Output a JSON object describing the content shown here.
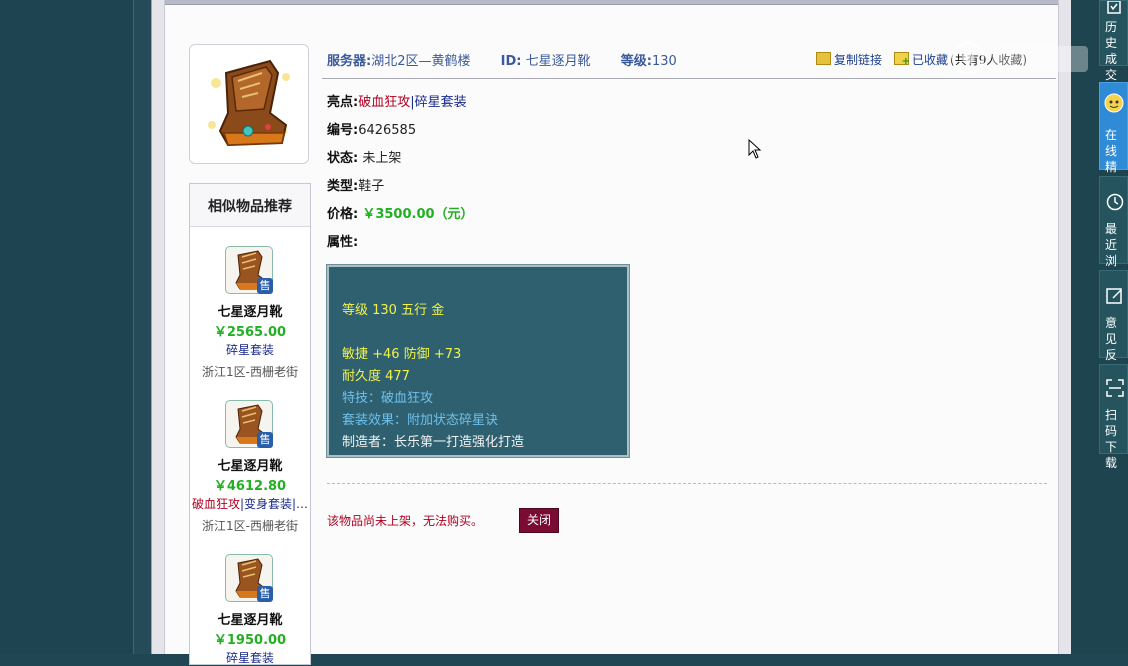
{
  "header": {
    "server_label": "服务器:",
    "server_value": "湖北2区—黄鹤楼",
    "id_label": "ID:",
    "id_value": "七星逐月靴",
    "level_label": "等级:",
    "level_value": "130",
    "copy_link": "复制链接",
    "favorited": "已收藏",
    "fav_count": "(共有9人收藏)"
  },
  "item": {
    "highlight_label": "亮点:",
    "highlight_a": "破血狂攻",
    "highlight_sep": "|",
    "highlight_b": "碎星套装",
    "number_label": "编号:",
    "number_value": "6426585",
    "status_label": "状态:",
    "status_value": "未上架",
    "type_label": "类型:",
    "type_value": "鞋子",
    "price_label": "价格:",
    "price_value": "￥3500.00（元）",
    "attr_label": "属性:"
  },
  "attributes": {
    "line1": "等级 130 五行 金",
    "line2": "敏捷 +46 防御 +73",
    "line3": "耐久度 477",
    "line4": "特技：破血狂攻",
    "line5": "套装效果：附加状态碎星诀",
    "line6": "制造者：长乐第一打造强化打造"
  },
  "footer": {
    "notice": "该物品尚未上架，无法购买。",
    "close_button": "关闭"
  },
  "similar": {
    "title": "相似物品推荐",
    "sell_badge": "售",
    "items": [
      {
        "name": "七星逐月靴",
        "price": "￥2565.00",
        "tag_red": "",
        "tag_blue": "碎星套装",
        "server": "浙江1区-西栅老街"
      },
      {
        "name": "七星逐月靴",
        "price": "￥4612.80",
        "tag_red": "破血狂攻",
        "tag_blue": "|变身套装|…",
        "server": "浙江1区-西栅老街"
      },
      {
        "name": "七星逐月靴",
        "price": "￥1950.00",
        "tag_red": "",
        "tag_blue": "碎星套装",
        "server": ""
      }
    ]
  },
  "sidebar": {
    "history": "历史成交",
    "online": "在线精灵",
    "recent": "最近浏览",
    "feedback": "意见反馈",
    "scan": "扫码下载"
  },
  "colors": {
    "price_green": "#21b021",
    "highlight_red": "#b00020",
    "attr_bg": "#2e6070",
    "close_btn": "#7a0b32"
  }
}
